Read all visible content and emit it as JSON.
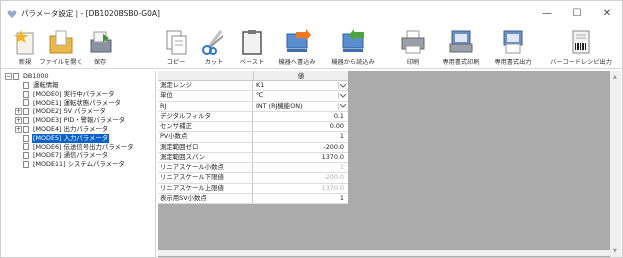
{
  "window": {
    "title": "パラメータ設定 | - [DB1020BSB0-G0A]",
    "controls": {
      "minimize": "—",
      "maximize": "☐",
      "close": "✕"
    }
  },
  "toolbar": {
    "new": "新規",
    "open": "ファイルを開く",
    "save": "保存",
    "copy": "コピー",
    "cut": "カット",
    "paste": "ペースト",
    "write_device": "機器へ書込み",
    "read_device": "機器から読込み",
    "print": "印刷",
    "custom_print": "専用書式印刷",
    "custom_output": "専用書式出力",
    "barcode_output": "バーコードレシピ出力"
  },
  "tree": {
    "root": "DB1000",
    "items": [
      {
        "label": "運転情報",
        "expander": ""
      },
      {
        "label": "[MODE0] 実行中パラメータ",
        "expander": ""
      },
      {
        "label": "[MODE1] 運転状態パラメータ",
        "expander": ""
      },
      {
        "label": "[MODE2] SV パラメータ",
        "expander": "+"
      },
      {
        "label": "[MODE3] PID・警報パラメータ",
        "expander": "+"
      },
      {
        "label": "[MODE4] 出力パラメータ",
        "expander": "+"
      },
      {
        "label": "[MODE5] 入力パラメータ",
        "expander": "",
        "selected": true
      },
      {
        "label": "[MODE6] 伝送信号出力パラメータ",
        "expander": ""
      },
      {
        "label": "[MODE7] 通信パラメータ",
        "expander": ""
      },
      {
        "label": "[MODE11] システムパラメータ",
        "expander": ""
      }
    ]
  },
  "grid": {
    "header": "値",
    "rows": [
      {
        "label": "測定レンジ",
        "value": "K1",
        "align": "left",
        "dropdown": true
      },
      {
        "label": "単位",
        "value": "℃",
        "align": "left",
        "dropdown": true
      },
      {
        "label": "RJ",
        "value": "INT (RJ機能ON)",
        "align": "left",
        "dropdown": true
      },
      {
        "label": "デジタルフィルタ",
        "value": "0.1",
        "align": "right"
      },
      {
        "label": "センサ補正",
        "value": "0.00",
        "align": "right"
      },
      {
        "label": "PV小数点",
        "value": "1",
        "align": "right"
      },
      {
        "label": "測定範囲ゼロ",
        "value": "-200.0",
        "align": "right"
      },
      {
        "label": "測定範囲スパン",
        "value": "1370.0",
        "align": "right"
      },
      {
        "label": "リニアスケール小数点",
        "value": "1",
        "align": "right",
        "gray": true
      },
      {
        "label": "リニアスケール下限値",
        "value": "-200.0",
        "align": "right",
        "gray": true
      },
      {
        "label": "リニアスケール上限値",
        "value": "1370.0",
        "align": "right",
        "gray": true
      },
      {
        "label": "表示用SV小数点",
        "value": "1",
        "align": "right"
      }
    ]
  },
  "colors": {
    "selection": "#0a62c8",
    "grid_background": "#ababab"
  }
}
